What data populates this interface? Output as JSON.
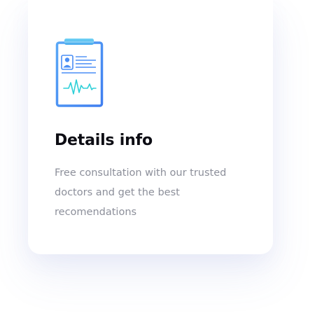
{
  "card": {
    "icon": "medical-clipboard-icon",
    "title": "Details info",
    "description": "Free consultation with our trusted doctors and get the best recomendations"
  },
  "colors": {
    "title": "#0d0d14",
    "description": "#8c8f9a",
    "icon_blue": "#4a8ef5",
    "icon_teal": "#2fd0d8"
  }
}
